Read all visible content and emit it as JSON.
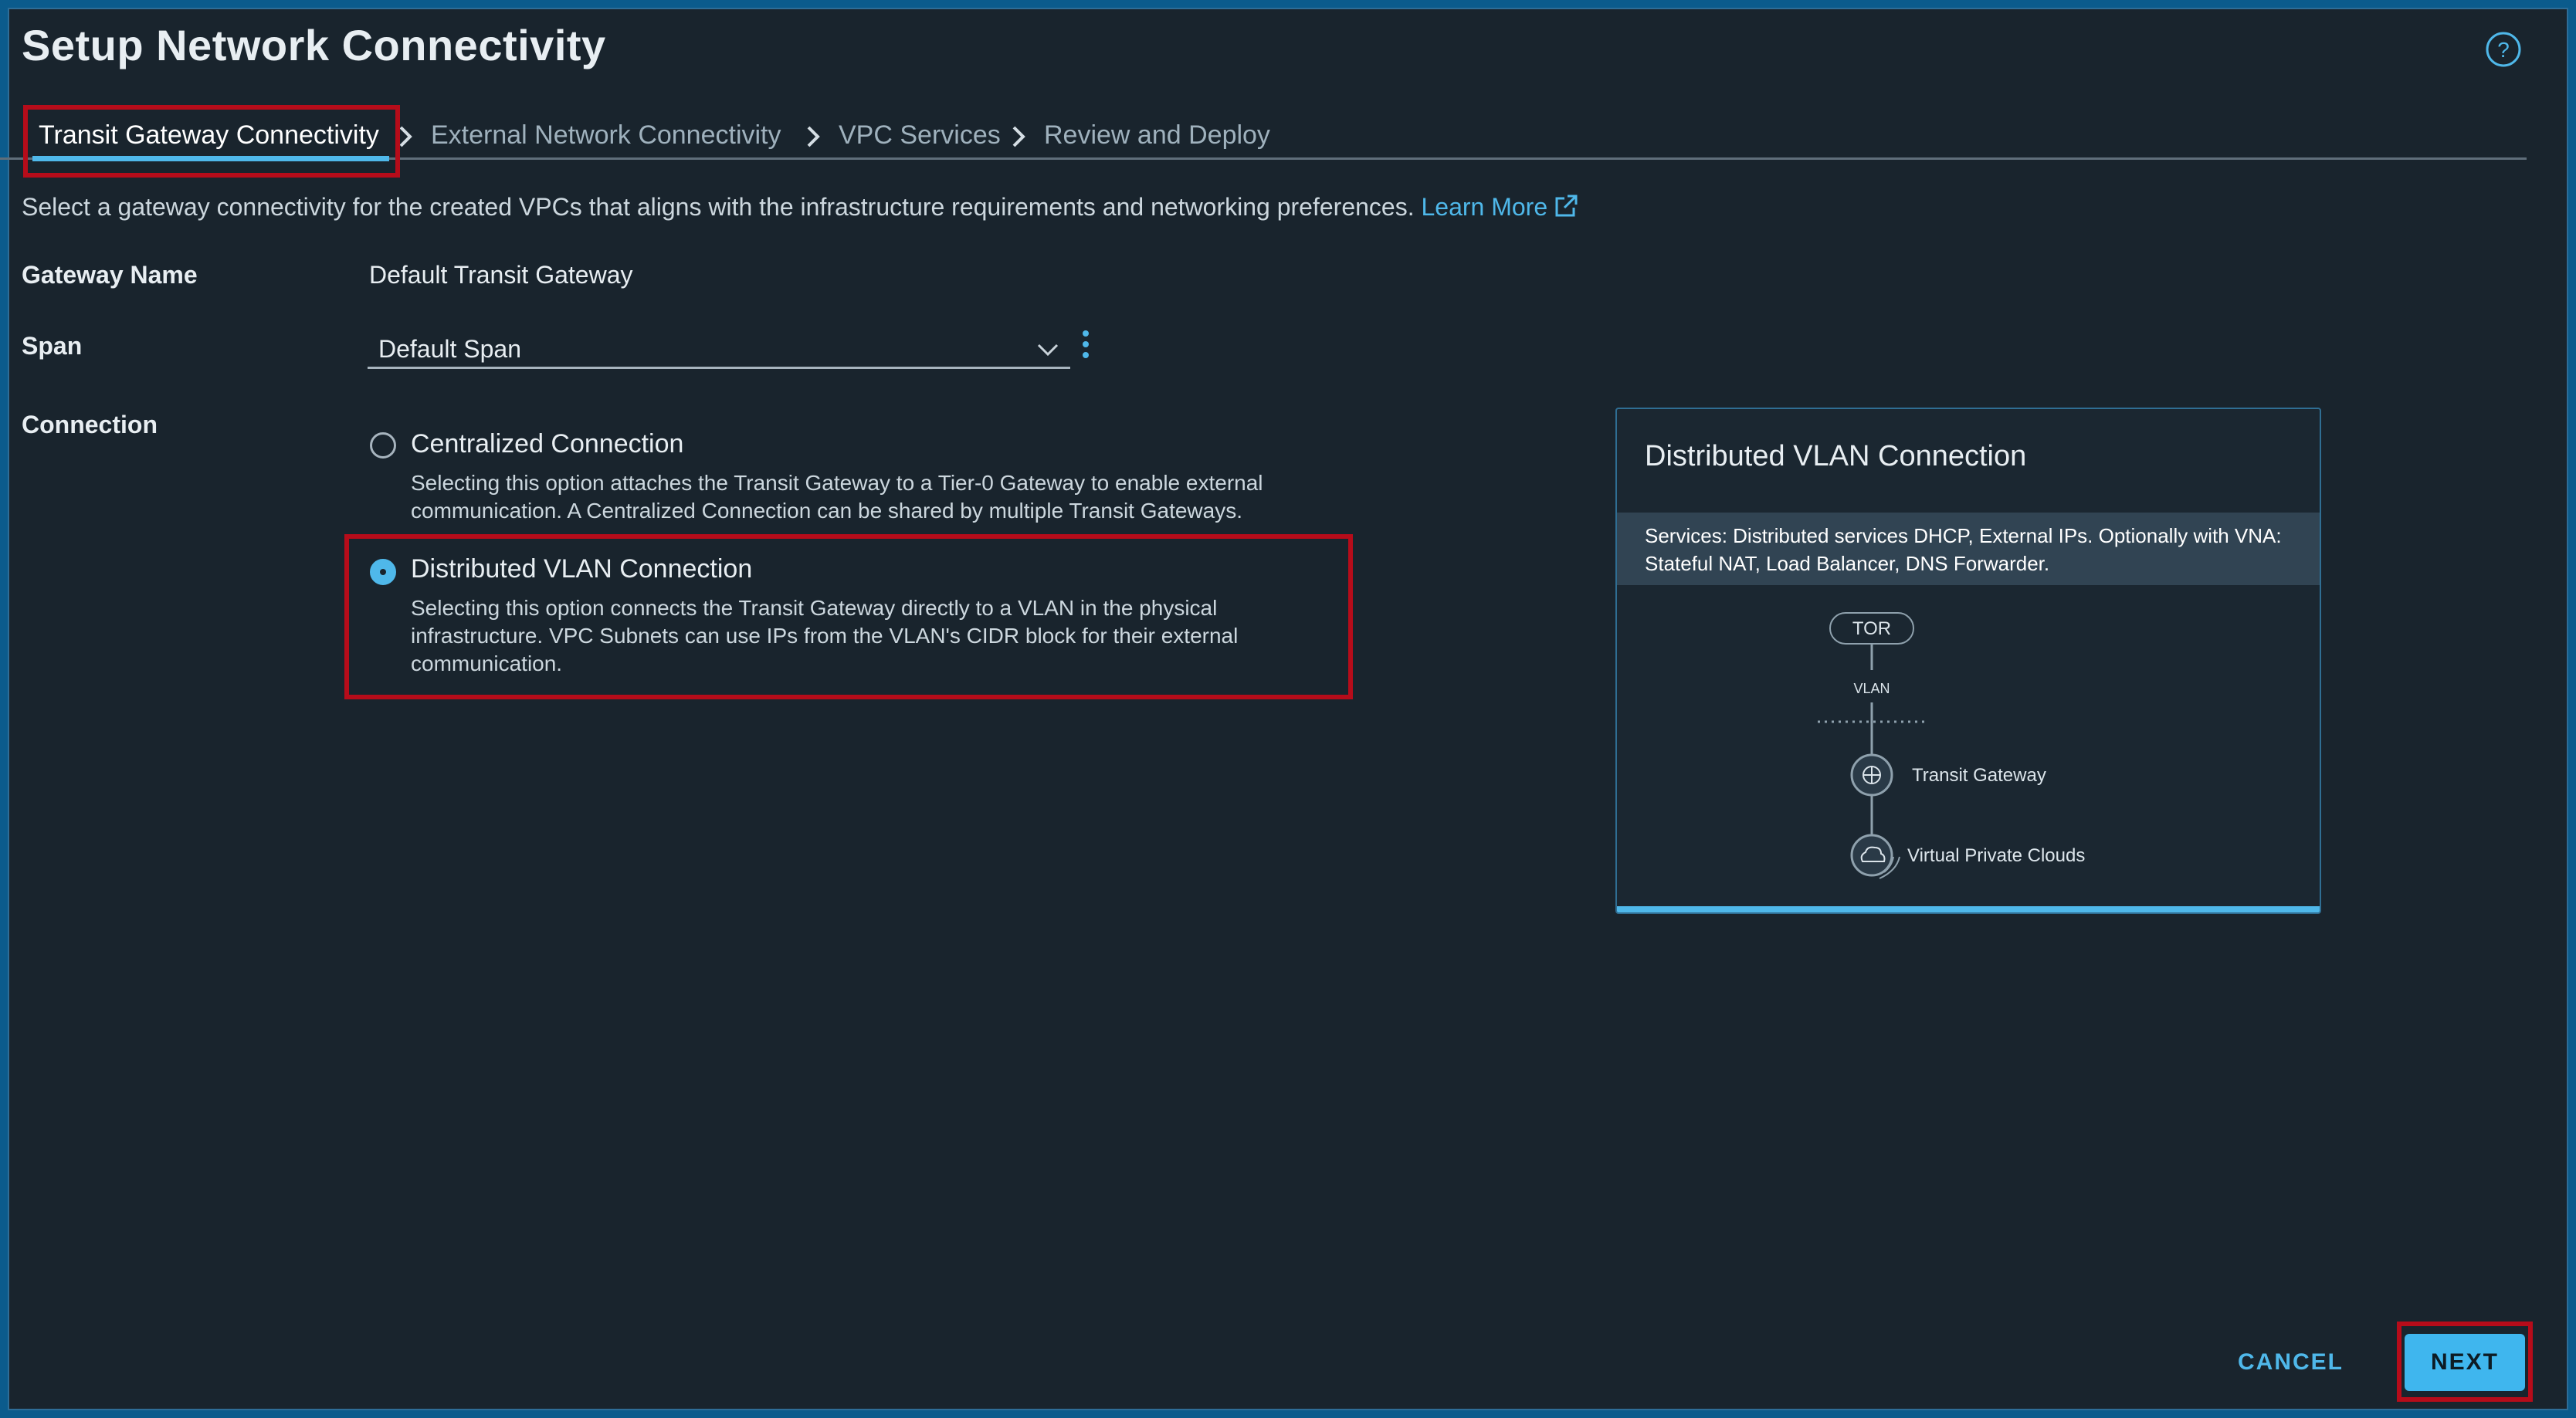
{
  "page": {
    "title": "Setup Network Connectivity"
  },
  "steps": [
    {
      "label": "Transit Gateway Connectivity",
      "active": true
    },
    {
      "label": "External Network Connectivity",
      "active": false
    },
    {
      "label": "VPC Services",
      "active": false
    },
    {
      "label": "Review and Deploy",
      "active": false
    }
  ],
  "intro": {
    "text": "Select a gateway connectivity for the created VPCs that aligns with the infrastructure requirements and networking preferences.",
    "link": "Learn More"
  },
  "form": {
    "gateway_name_label": "Gateway Name",
    "gateway_name_value": "Default Transit Gateway",
    "span_label": "Span",
    "span_value": "Default Span",
    "connection_label": "Connection",
    "options": [
      {
        "title": "Centralized Connection",
        "desc": "Selecting this option attaches the Transit Gateway to a Tier-0 Gateway to enable external communication. A Centralized Connection can be shared by multiple Transit Gateways.",
        "checked": false
      },
      {
        "title": "Distributed VLAN Connection",
        "desc": "Selecting this option connects the Transit Gateway directly to a VLAN in the physical infrastructure. VPC Subnets can use IPs from the VLAN's CIDR block for their external communication.",
        "checked": true
      }
    ]
  },
  "panel": {
    "title": "Distributed VLAN Connection",
    "services": "Services: Distributed services DHCP, External IPs. Optionally with VNA: Stateful NAT, Load Balancer, DNS Forwarder.",
    "diagram": {
      "tor": "TOR",
      "vlan": "VLAN",
      "transit_gateway": "Transit Gateway",
      "vpc": "Virtual Private Clouds"
    }
  },
  "footer": {
    "cancel": "CANCEL",
    "next": "NEXT"
  },
  "colors": {
    "accent": "#4fb8ea",
    "highlight": "#b60c1a",
    "background": "#19242d"
  }
}
